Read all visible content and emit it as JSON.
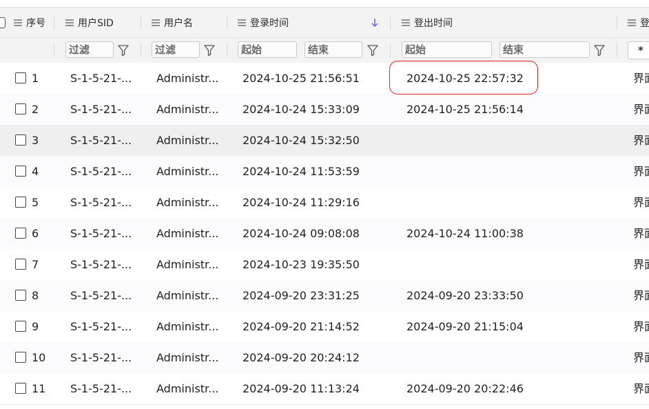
{
  "header": {
    "columns": [
      {
        "label": "序号"
      },
      {
        "label": "用户SID"
      },
      {
        "label": "用户名"
      },
      {
        "label": "登录时间"
      },
      {
        "label": "登出时间"
      },
      {
        "label": "登"
      }
    ]
  },
  "filters": {
    "seq": "过滤",
    "sid": "过滤",
    "login_start": "起始",
    "login_end": "结束",
    "logout_start": "起始",
    "logout_end": "结束",
    "type": "*"
  },
  "rows": [
    {
      "no": "1",
      "sid": "S-1-5-21-...",
      "user": "Administr...",
      "login": "2024-10-25 21:56:51",
      "logout": "2024-10-25 22:57:32",
      "type": "界面"
    },
    {
      "no": "2",
      "sid": "S-1-5-21-...",
      "user": "Administr...",
      "login": "2024-10-24 15:33:09",
      "logout": "2024-10-25 21:56:14",
      "type": "界面"
    },
    {
      "no": "3",
      "sid": "S-1-5-21-...",
      "user": "Administr...",
      "login": "2024-10-24 15:32:50",
      "logout": "",
      "type": "界面"
    },
    {
      "no": "4",
      "sid": "S-1-5-21-...",
      "user": "Administr...",
      "login": "2024-10-24 11:53:59",
      "logout": "",
      "type": "界面"
    },
    {
      "no": "5",
      "sid": "S-1-5-21-...",
      "user": "Administr...",
      "login": "2024-10-24 11:29:16",
      "logout": "",
      "type": "界面"
    },
    {
      "no": "6",
      "sid": "S-1-5-21-...",
      "user": "Administr...",
      "login": "2024-10-24 09:08:08",
      "logout": "2024-10-24 11:00:38",
      "type": "界面"
    },
    {
      "no": "7",
      "sid": "S-1-5-21-...",
      "user": "Administr...",
      "login": "2024-10-23 19:35:50",
      "logout": "",
      "type": "界面"
    },
    {
      "no": "8",
      "sid": "S-1-5-21-...",
      "user": "Administr...",
      "login": "2024-09-20 23:31:25",
      "logout": "2024-09-20 23:33:50",
      "type": "界面"
    },
    {
      "no": "9",
      "sid": "S-1-5-21-...",
      "user": "Administr...",
      "login": "2024-09-20 21:14:52",
      "logout": "2024-09-20 21:15:04",
      "type": "界面"
    },
    {
      "no": "10",
      "sid": "S-1-5-21-...",
      "user": "Administr...",
      "login": "2024-09-20 20:24:12",
      "logout": "",
      "type": "界面"
    },
    {
      "no": "11",
      "sid": "S-1-5-21-...",
      "user": "Administr...",
      "login": "2024-09-20 11:13:24",
      "logout": "2024-09-20 20:22:46",
      "type": "界面"
    }
  ],
  "colors": {
    "sort_arrow": "#5b5bd6",
    "callout": "#e0241b",
    "selected_row": "#efefef"
  }
}
